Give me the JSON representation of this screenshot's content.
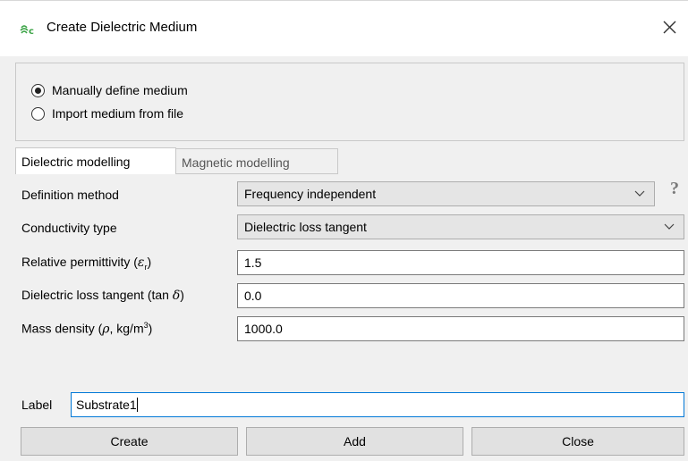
{
  "window": {
    "title": "Create Dielectric Medium",
    "app_icon": "cadfeko-logo-icon",
    "close_icon": "close-icon"
  },
  "source": {
    "options": [
      {
        "label": "Manually define medium",
        "checked": true
      },
      {
        "label": "Import medium from file",
        "checked": false
      }
    ]
  },
  "tabs": [
    {
      "label": "Dielectric modelling",
      "active": true
    },
    {
      "label": "Magnetic modelling",
      "active": false
    }
  ],
  "form": {
    "definition_method": {
      "label": "Definition method",
      "value": "Frequency independent"
    },
    "conductivity_type": {
      "label": "Conductivity type",
      "value": "Dielectric loss tangent"
    },
    "relative_permittivity": {
      "label_prefix": "Relative permittivity (",
      "symbol": "ε",
      "subscript": "r",
      "label_suffix": ")",
      "value": "1.5"
    },
    "loss_tangent": {
      "label_prefix": "Dielectric loss tangent (tan ",
      "symbol": "δ",
      "label_suffix": ")",
      "value": "0.0"
    },
    "mass_density": {
      "label_prefix": "Mass density (",
      "symbol": "ρ",
      "label_mid": ", kg/m",
      "superscript": "3",
      "label_suffix": ")",
      "value": "1000.0"
    },
    "help": "?"
  },
  "label_field": {
    "label": "Label",
    "value": "Substrate1"
  },
  "buttons": {
    "create": "Create",
    "add": "Add",
    "close": "Close"
  }
}
